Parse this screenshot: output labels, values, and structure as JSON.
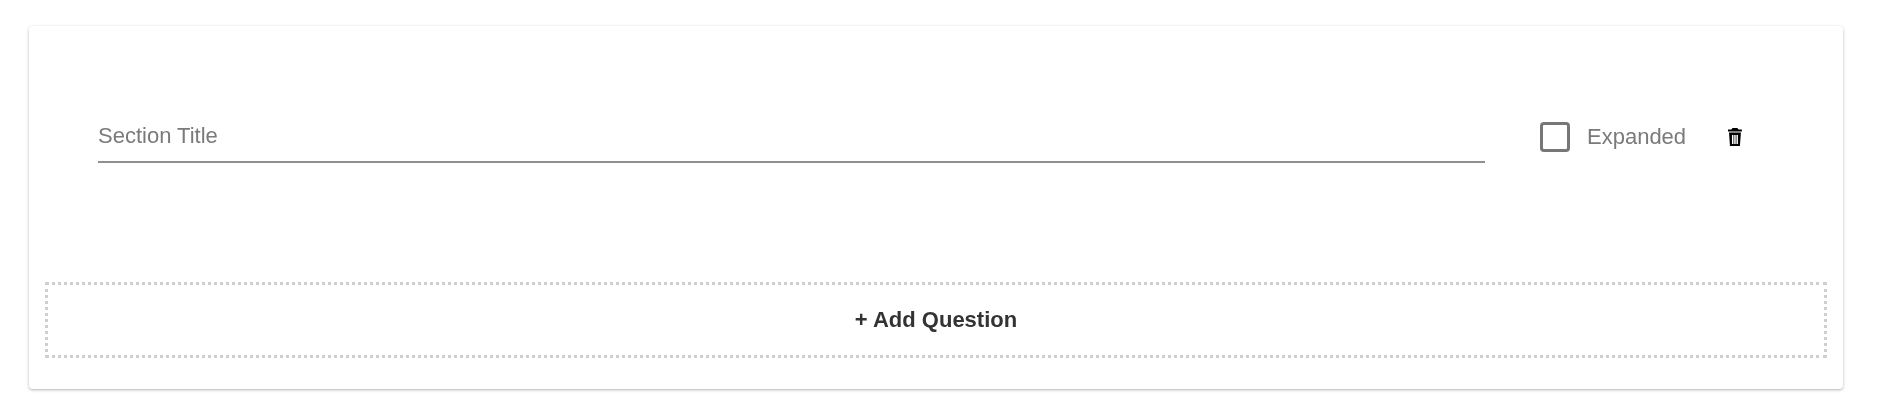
{
  "section": {
    "title_field": {
      "placeholder": "Section Title"
    },
    "expanded_checkbox": {
      "label": "Expanded",
      "checked": false
    },
    "add_button": {
      "label": "+ Add Question"
    }
  }
}
